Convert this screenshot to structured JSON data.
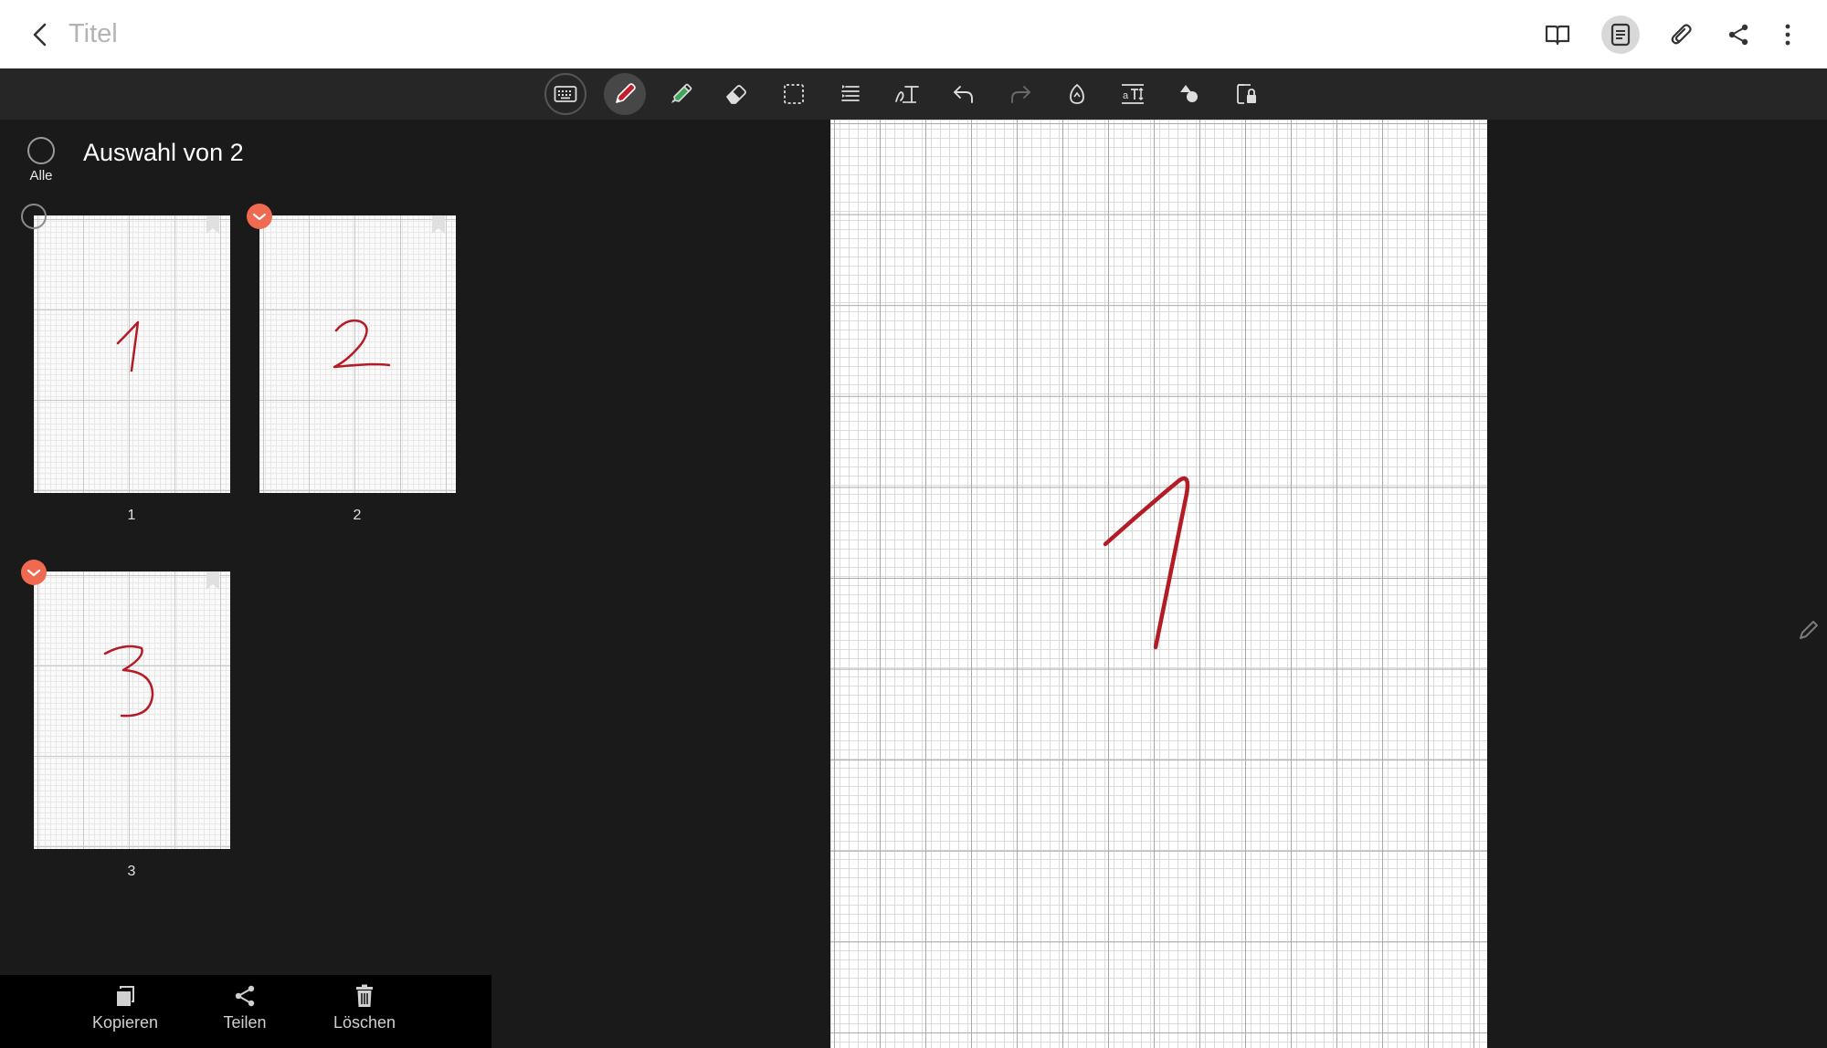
{
  "header": {
    "title": "Titel",
    "icons": [
      "back-icon",
      "book-icon",
      "page-view-icon",
      "attach-icon",
      "share-icon",
      "more-icon"
    ]
  },
  "toolbar": {
    "tools": [
      "keyboard",
      "pen",
      "highlighter",
      "eraser",
      "selection",
      "text-align",
      "handwriting-to-text",
      "undo",
      "redo",
      "lasso",
      "text-resize",
      "shapes",
      "lock-page"
    ],
    "active_tool": "pen",
    "pen_color": "#c0202a"
  },
  "sidebar": {
    "select_all_label": "Alle",
    "selection_title": "Auswahl von 2",
    "pages": [
      {
        "number": "1",
        "content": "1",
        "selected": false
      },
      {
        "number": "2",
        "content": "2",
        "selected": true
      },
      {
        "number": "3",
        "content": "3",
        "selected": true
      }
    ],
    "check_color": "#f06a52"
  },
  "bottom_actions": {
    "copy_label": "Kopieren",
    "share_label": "Teilen",
    "delete_label": "Löschen"
  },
  "canvas": {
    "content": "1",
    "ink_color": "#b31c25"
  }
}
